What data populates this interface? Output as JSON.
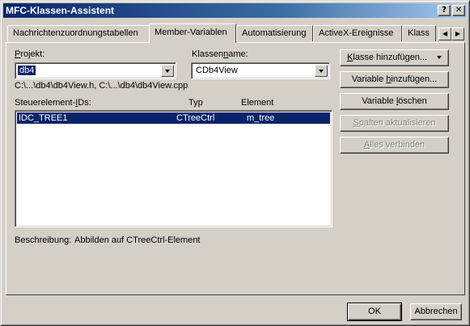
{
  "window": {
    "title": "MFC-Klassen-Assistent",
    "help_glyph": "?",
    "close_glyph": "✕"
  },
  "tabs": [
    {
      "label": "Nachrichtenzuordnungstabellen",
      "active": false
    },
    {
      "label": "Member-Variablen",
      "active": true
    },
    {
      "label": "Automatisierung",
      "active": false
    },
    {
      "label": "ActiveX-Ereignisse",
      "active": false
    },
    {
      "label": "Klass",
      "active": false
    }
  ],
  "tab_scroll": {
    "left": "◀",
    "right": "▶"
  },
  "project": {
    "label_hotkey": "P",
    "label_rest": "rojekt:",
    "value": "db4"
  },
  "classname": {
    "label_pre": "Klassen",
    "label_hotkey": "n",
    "label_post": "ame:",
    "value": "CDb4View"
  },
  "file_path": "C:\\...\\db4\\db4View.h, C:\\...\\db4\\db4View.cpp",
  "list": {
    "col_ids_pre": "Steuerelement-",
    "col_ids_hotkey": "I",
    "col_ids_post": "Ds:",
    "col_type": "Typ",
    "col_element": "Element",
    "rows": [
      {
        "id": "IDC_TREE1",
        "type": "CTreeCtrl",
        "element": "m_tree",
        "selected": true
      }
    ]
  },
  "description": {
    "label": "Beschreibung:",
    "value": "Abbilden auf CTreeCtrl-Element"
  },
  "buttons": {
    "add_class_hotkey": "K",
    "add_class_rest": "lasse hinzufügen...",
    "add_variable_pre": "Variable ",
    "add_variable_hotkey": "h",
    "add_variable_post": "inzufügen...",
    "delete_variable_pre": "Variable ",
    "delete_variable_hotkey": "l",
    "delete_variable_post": "öschen",
    "update_columns_hotkey": "S",
    "update_columns_rest": "palten aktualisieren",
    "bind_all_hotkey": "A",
    "bind_all_rest": "lles verbinden",
    "ok": "OK",
    "cancel": "Abbrechen"
  },
  "colors": {
    "face": "#d4d0c8",
    "selection": "#0a246a",
    "title_start": "#0a246a",
    "title_end": "#a6caf0"
  }
}
